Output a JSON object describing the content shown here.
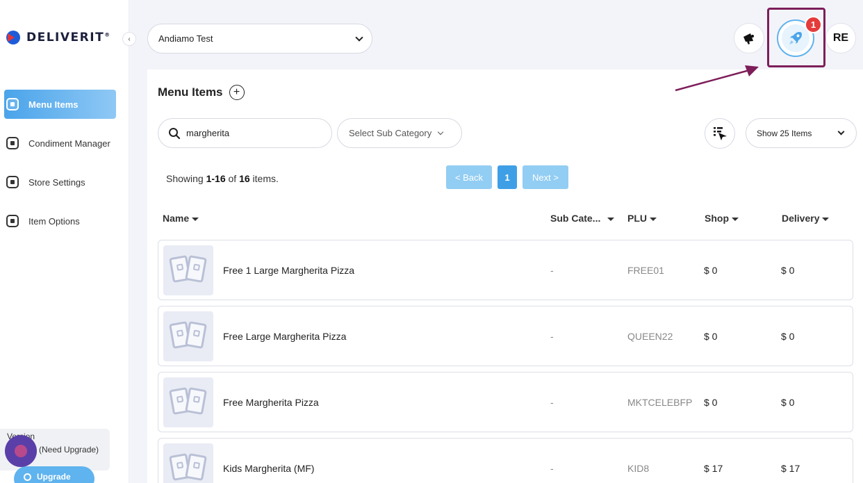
{
  "brand": {
    "name": "DELIVERIT",
    "mark": "®"
  },
  "sidebar": {
    "items": [
      {
        "label": "Menu Items",
        "active": true
      },
      {
        "label": "Condiment Manager",
        "active": false
      },
      {
        "label": "Store Settings",
        "active": false
      },
      {
        "label": "Item Options",
        "active": false
      }
    ],
    "version_title": "Version",
    "version_note": "(Need Upgrade)",
    "upgrade_label": "Upgrade"
  },
  "header": {
    "store_name": "Andiamo Test",
    "notification_count": "1",
    "avatar_initials": "RE"
  },
  "main": {
    "title": "Menu Items",
    "search_value": "margherita",
    "subcategory_placeholder": "Select Sub Category",
    "per_page": "Show 25 Items",
    "showing": {
      "prefix": "Showing ",
      "range": "1-16",
      "of": " of ",
      "total": "16",
      "suffix": " items."
    },
    "pager": {
      "back": "< Back",
      "current": "1",
      "next": "Next >"
    },
    "columns": {
      "name": "Name",
      "subcategory": "Sub Cate...",
      "plu": "PLU",
      "shop": "Shop",
      "delivery": "Delivery"
    },
    "rows": [
      {
        "name": "Free 1 Large Margherita Pizza",
        "subcategory": "-",
        "plu": "FREE01",
        "shop": "$ 0",
        "delivery": "$ 0"
      },
      {
        "name": "Free Large Margherita Pizza",
        "subcategory": "-",
        "plu": "QUEEN22",
        "shop": "$ 0",
        "delivery": "$ 0"
      },
      {
        "name": "Free Margherita Pizza",
        "subcategory": "-",
        "plu": "MKTCELEBFP",
        "shop": "$ 0",
        "delivery": "$ 0"
      },
      {
        "name": "Kids Margherita (MF)",
        "subcategory": "-",
        "plu": "KID8",
        "shop": "$ 17",
        "delivery": "$ 17"
      }
    ]
  },
  "colors": {
    "accent": "#4aa4ea",
    "badge": "#e53b3b",
    "highlight": "#7d1e5a",
    "chat": "#5a3fa8"
  }
}
